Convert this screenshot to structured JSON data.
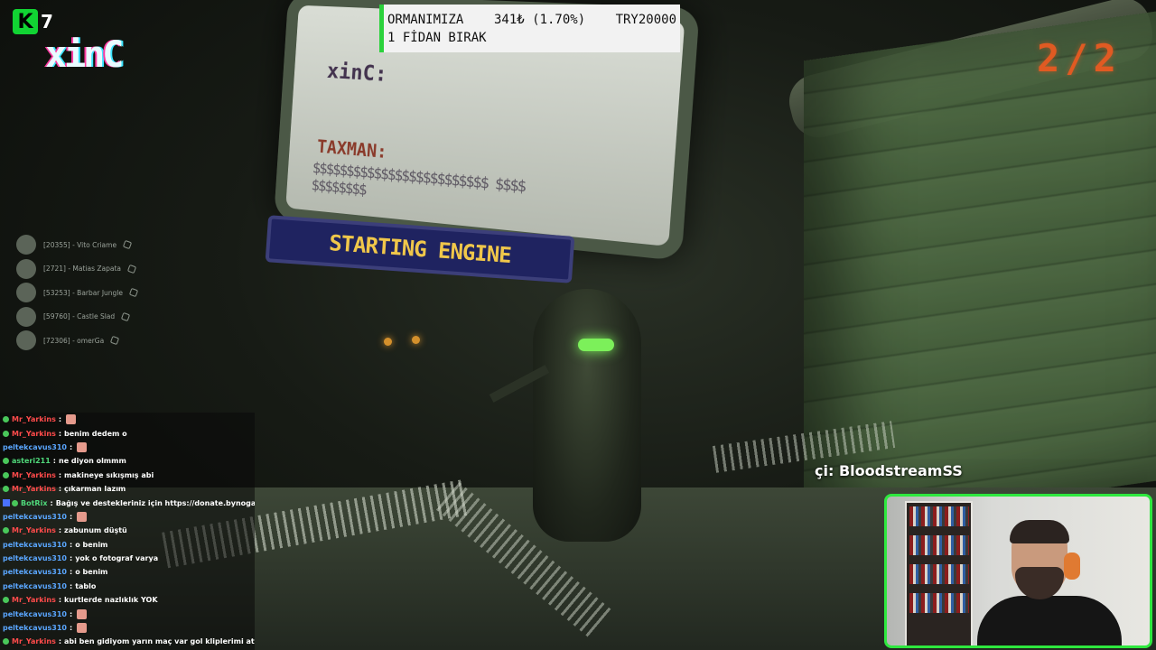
{
  "overlay": {
    "logo_letter": "K",
    "logo_number": "7",
    "player_tag": "xinC",
    "round_counter": "2/2",
    "streamer_credit": "çi: BloodstreamSS"
  },
  "donation": {
    "title_line1": "ORMANIMIZA",
    "amount": "341₺ (1.70%)",
    "goal": "TRY20000",
    "title_line2": "1 FİDAN BIRAK"
  },
  "game_screen": {
    "player_label": "xinC:",
    "taxman_label": "TAXMAN:",
    "money_text": "$$$$$$$$$$$$$$$$$$$$$$$$$ $$$$ $$$$$$$$",
    "banner": "STARTING ENGINE"
  },
  "viewers": [
    {
      "name": "[20355] - Vito Criame"
    },
    {
      "name": "[2721] - Matias Zapata"
    },
    {
      "name": "[53253] - Barbar Jungle"
    },
    {
      "name": "[59760] - Castle Slad"
    },
    {
      "name": "[72306] - omerGa"
    }
  ],
  "chat": [
    {
      "user": "Mr_Yarkins",
      "msg": "",
      "color": "red"
    },
    {
      "user": "Mr_Yarkins",
      "msg": "benim dedem o",
      "color": "red"
    },
    {
      "user": "peltekcavus310",
      "msg": "",
      "color": "blue"
    },
    {
      "user": "asteri211",
      "msg": "ne diyon olmmm",
      "color": "green"
    },
    {
      "user": "Mr_Yarkins",
      "msg": "makineye sıkışmış abi",
      "color": "red"
    },
    {
      "user": "Mr_Yarkins",
      "msg": "çıkarman lazım",
      "color": "red"
    },
    {
      "user": "BotRix",
      "msg": "Bağış ve destekleriniz için https://donate.bynogame.com/isla",
      "color": "green"
    },
    {
      "user": "peltekcavus310",
      "msg": "",
      "color": "blue"
    },
    {
      "user": "Mr_Yarkins",
      "msg": "zabunum düştü",
      "color": "red"
    },
    {
      "user": "peltekcavus310",
      "msg": "o benim",
      "color": "blue"
    },
    {
      "user": "peltekcavus310",
      "msg": "yok o fotograf varya",
      "color": "blue"
    },
    {
      "user": "peltekcavus310",
      "msg": "o benim",
      "color": "blue"
    },
    {
      "user": "peltekcavus310",
      "msg": "tablo",
      "color": "blue"
    },
    {
      "user": "Mr_Yarkins",
      "msg": "kurtlerde nazlıklık YOK",
      "color": "red"
    },
    {
      "user": "peltekcavus310",
      "msg": "",
      "color": "blue"
    },
    {
      "user": "peltekcavus310",
      "msg": "",
      "color": "blue"
    },
    {
      "user": "Mr_Yarkins",
      "msg": "abi ben gidiyom yarın maç var gol kliplerimi atarımmssss",
      "color": "red"
    }
  ],
  "colors": {
    "accent_green": "#2ee83e",
    "round_orange": "#e05a22"
  }
}
